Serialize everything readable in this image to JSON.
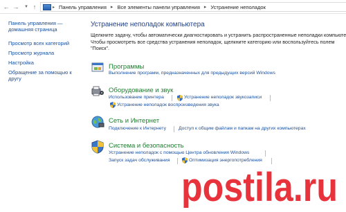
{
  "addressbar": {
    "crumbs": [
      "Панель управления",
      "Все элементы панели управления",
      "Устранение неполадок"
    ]
  },
  "leftpane": {
    "home": "Панель управления — домашняя страница",
    "links": [
      "Просмотр всех категорий",
      "Просмотр журнала",
      "Настройка",
      "Обращение за помощью к другу"
    ]
  },
  "main": {
    "title": "Устранение неполадок компьютера",
    "description": "Щелкните задачу, чтобы автоматически диагностировать и устранить распространенные неполадки компьютера. Чтобы просмотреть все средства устранения неполадок, щелкните категорию или воспользуйтесь полем \"Поиск\"."
  },
  "categories": [
    {
      "title": "Программы",
      "icon": "programs-icon",
      "links": [
        "Выполнение программ, предназначенных для предыдущих версий Windows"
      ]
    },
    {
      "title": "Оборудование и звук",
      "icon": "hardware-sound-icon",
      "links": [
        "Использование принтера",
        "Устранение неполадок звукозаписи",
        "Устранение неполадок воспроизведения звука"
      ]
    },
    {
      "title": "Сеть и Интернет",
      "icon": "network-icon",
      "links": [
        "Подключение к Интернету",
        "Доступ к общим файлам и папкам на других компьютерах"
      ]
    },
    {
      "title": "Система и безопасность",
      "icon": "system-security-icon",
      "links": [
        "Устранение неполадок с помощью Центра обновления Windows",
        "Запуск задач обслуживания",
        "Оптимизация энергопотребления"
      ]
    }
  ],
  "watermark": {
    "text": "postila.ru",
    "color": "#e8323c"
  },
  "colors": {
    "link": "#1a50a0",
    "category_title": "#1e7f2f",
    "page_title": "#1f3f86"
  }
}
